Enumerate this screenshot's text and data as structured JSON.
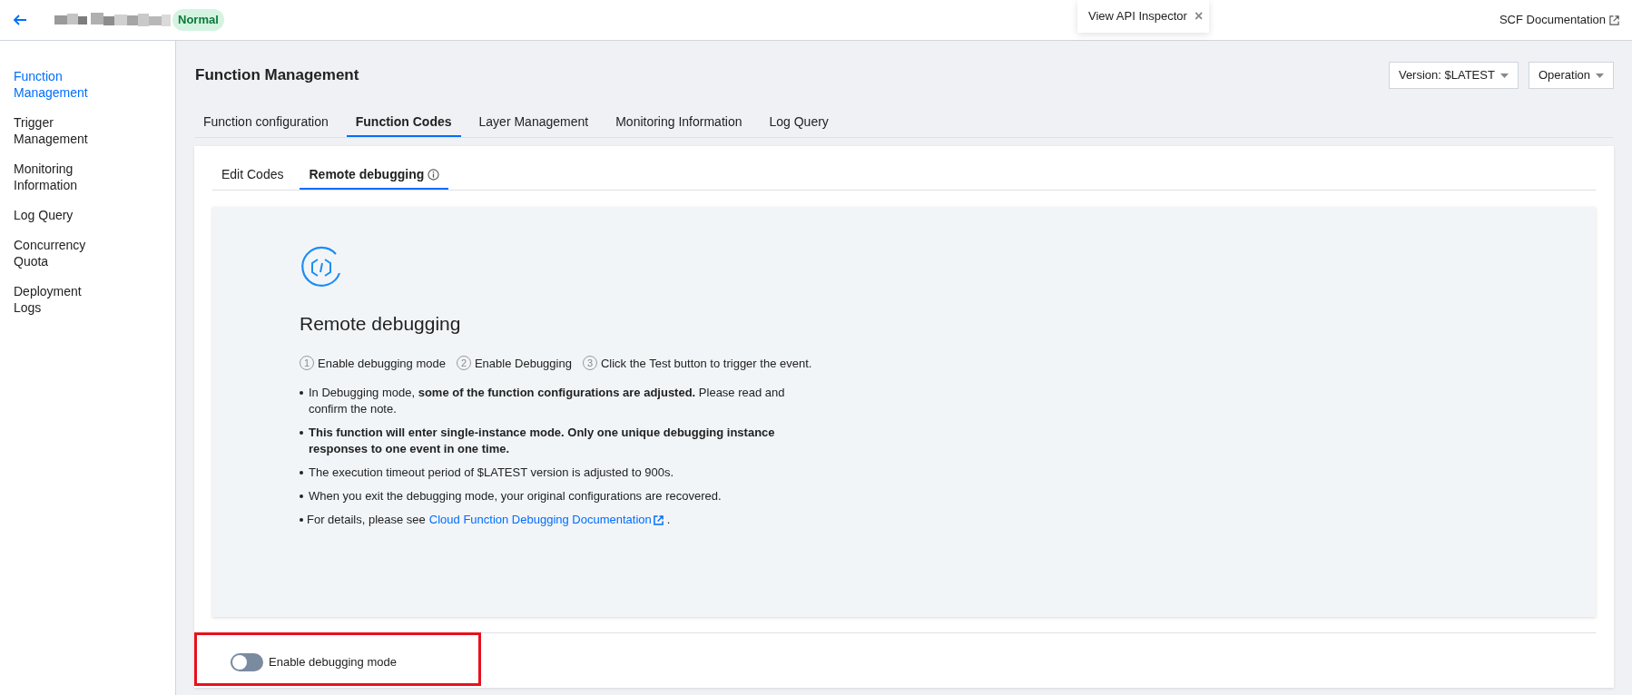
{
  "header": {
    "status_badge": "Normal",
    "inspector": {
      "label": "View API Inspector",
      "close": "×"
    },
    "doc_link": "SCF Documentation"
  },
  "sidebar": {
    "items": [
      {
        "label": "Function Management",
        "selected": true
      },
      {
        "label": "Trigger Management",
        "selected": false
      },
      {
        "label": "Monitoring Information",
        "selected": false
      },
      {
        "label": "Log Query",
        "selected": false
      },
      {
        "label": "Concurrency Quota",
        "selected": false
      },
      {
        "label": "Deployment Logs",
        "selected": false
      }
    ]
  },
  "page": {
    "title": "Function Management",
    "version_dropdown": "Version: $LATEST",
    "operation_dropdown": "Operation"
  },
  "tabs": [
    {
      "label": "Function configuration",
      "selected": false
    },
    {
      "label": "Function Codes",
      "selected": true
    },
    {
      "label": "Layer Management",
      "selected": false
    },
    {
      "label": "Monitoring Information",
      "selected": false
    },
    {
      "label": "Log Query",
      "selected": false
    }
  ],
  "sub_tabs": [
    {
      "label": "Edit Codes",
      "selected": false,
      "info": false
    },
    {
      "label": "Remote debugging",
      "selected": true,
      "info": true
    }
  ],
  "debug_panel": {
    "heading": "Remote debugging",
    "steps": [
      {
        "number": "1",
        "label": "Enable debugging mode"
      },
      {
        "number": "2",
        "label": "Enable Debugging"
      },
      {
        "number": "3",
        "label": "Click the Test button to trigger the event."
      }
    ],
    "notes": [
      {
        "text": "In Debugging mode, **some of the function configurations are adjusted.** Please read and confirm the note."
      },
      {
        "text": "This function will enter single-instance mode. Only one unique debugging instance responses to one event in one time.",
        "bold": true
      },
      {
        "text": "The execution timeout period of $LATEST version is adjusted to 900s."
      },
      {
        "text": "When you exit the debugging mode, your original configurations are recovered."
      },
      {
        "text": "For details, please see ",
        "link": "Cloud Function Debugging Documentation",
        "after": "."
      }
    ]
  },
  "debug_toggle": {
    "label": "Enable debugging mode",
    "on": false,
    "highlighted": true
  }
}
